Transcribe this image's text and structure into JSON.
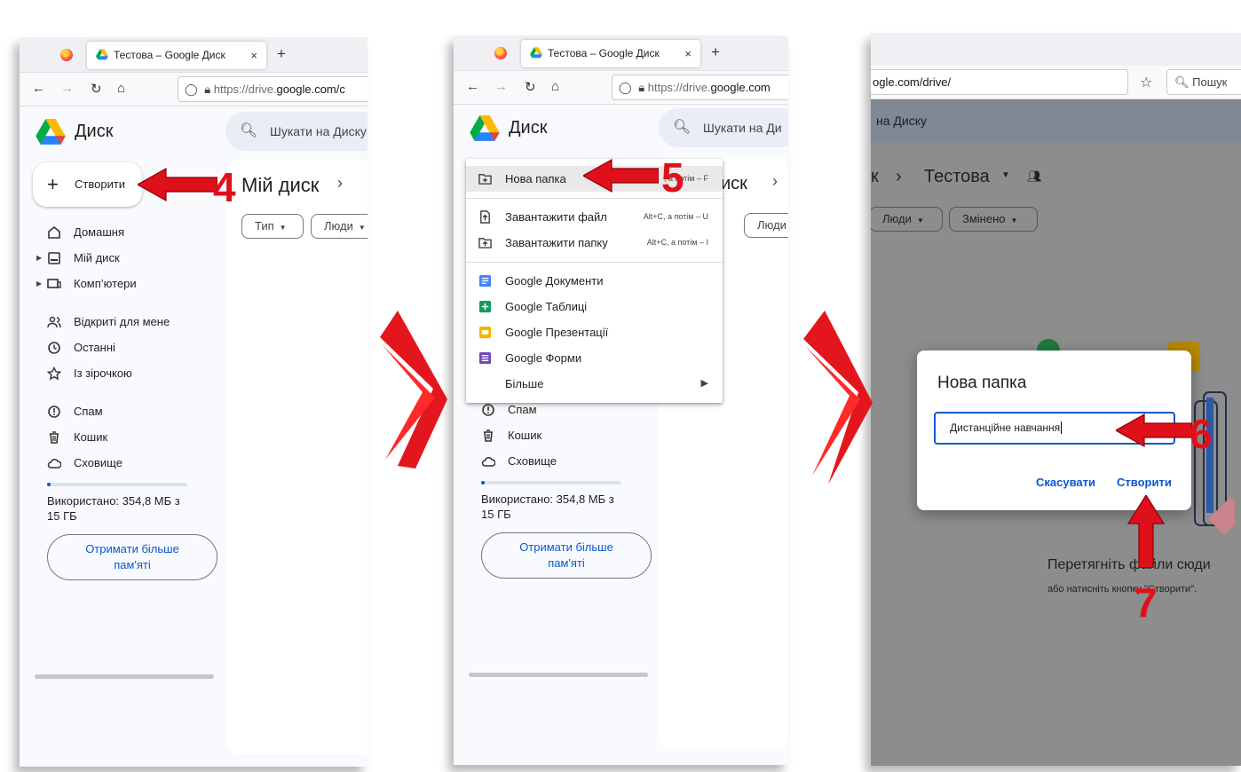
{
  "colors": {
    "accent": "#0b57d0",
    "annotation_red": "#e0101a",
    "drive_bg": "#f8fafd"
  },
  "browser": {
    "tab_title": "Тестова – Google Диск",
    "tab_close": "×",
    "new_tab": "+",
    "url_prefix": "https://drive.",
    "url_host": "google.com/c",
    "url_prefix_2": "https://drive.",
    "url_host_2": "google.com",
    "url_partial": "ogle.com/drive/",
    "search_engine_label": "Пошук"
  },
  "drive": {
    "app_name": "Диск",
    "search_placeholder": "Шукати на Диску",
    "search_placeholder_2": "Шукати на Ди",
    "create_label": "Створити",
    "sidebar": {
      "home": "Домашня",
      "my_drive": "Мій диск",
      "computers": "Комп’ютери",
      "shared": "Відкриті для мене",
      "recent": "Останні",
      "starred": "Із зірочкою",
      "spam": "Спам",
      "trash": "Кошик",
      "storage": "Сховище"
    },
    "storage_text_1": "Використано: 354,8 МБ з",
    "storage_text_2": "15 ГБ",
    "storage_fraction": 0.023,
    "more_storage_1": "Отримати більше",
    "more_storage_2": "пам'яті",
    "main_title": "Мій диск",
    "main_title_cut": "иск",
    "chips": {
      "type": "Тип",
      "people": "Люди",
      "modified": "Змінено"
    }
  },
  "menu": {
    "items": [
      {
        "label": "Нова папка",
        "shortcut": "Alt+C, а потім – F"
      },
      {
        "label": "Завантажити файл",
        "shortcut": "Alt+C, а потім – U"
      },
      {
        "label": "Завантажити папку",
        "shortcut": "Alt+C, а потім – I"
      },
      {
        "label": "Google Документи"
      },
      {
        "label": "Google Таблиці"
      },
      {
        "label": "Google Презентації"
      },
      {
        "label": "Google Форми"
      },
      {
        "label": "Більше"
      }
    ],
    "shortcut_partial": ", а потім – F"
  },
  "panel3": {
    "search_partial": "на Диску",
    "breadcrumb_prev": "к",
    "breadcrumb_current": "Тестова",
    "empty_title": "Перетягніть файли сюди",
    "empty_hint": "або натисніть кнопку \"Створити\"."
  },
  "dialog": {
    "title": "Нова папка",
    "input_value": "Дистанційне навчання",
    "cancel": "Скасувати",
    "create": "Створити"
  },
  "annotations": [
    "4",
    "5",
    "6",
    "7"
  ]
}
